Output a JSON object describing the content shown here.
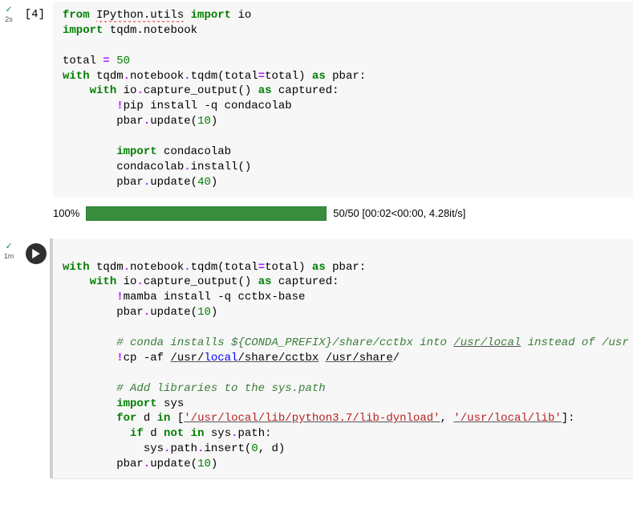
{
  "cell1": {
    "check": "✓",
    "timing": "2s",
    "prompt": "[4]",
    "code": {
      "l1": {
        "kw_from": "from",
        "mod": "IPython.utils",
        "kw_import": "import",
        "name": "io"
      },
      "l2": {
        "kw_import": "import",
        "name": "tqdm.notebook"
      },
      "l3": {
        "a": "total ",
        "b": "=",
        "c": " ",
        "d": "50"
      },
      "l4": {
        "a": "with",
        "b": " tqdm",
        "c": ".",
        "d": "notebook",
        "e": ".",
        "f": "tqdm",
        "g": "(",
        "h": "total",
        "i": "=",
        "j": "total",
        "k": ")",
        "l": " ",
        "m": "as",
        "n": " pbar:"
      },
      "l5": {
        "a": "with",
        "b": " io",
        "c": ".",
        "d": "capture_output",
        "e": "()",
        "f": " ",
        "g": "as",
        "h": " captured:"
      },
      "l6": {
        "a": "!",
        "b": "pip install -q condacolab"
      },
      "l7": {
        "a": "pbar",
        "b": ".",
        "c": "update",
        "d": "(",
        "e": "10",
        "f": ")"
      },
      "l8": {
        "a": "import",
        "b": " condacolab"
      },
      "l9": {
        "a": "condacolab",
        "b": ".",
        "c": "install",
        "d": "()"
      },
      "l10": {
        "a": "pbar",
        "b": ".",
        "c": "update",
        "d": "(",
        "e": "40",
        "f": ")"
      }
    },
    "output": {
      "percent": "100%",
      "stats": "50/50 [00:02<00:00, 4.28it/s]"
    }
  },
  "cell2": {
    "check": "✓",
    "timing": "1m",
    "code": {
      "l1": {
        "a": "with",
        "b": " tqdm",
        "c": ".",
        "d": "notebook",
        "e": ".",
        "f": "tqdm",
        "g": "(",
        "h": "total",
        "i": "=",
        "j": "total",
        "k": ")",
        "l": " ",
        "m": "as",
        "n": " pbar:"
      },
      "l2": {
        "a": "with",
        "b": " io",
        "c": ".",
        "d": "capture_output",
        "e": "()",
        "f": " ",
        "g": "as",
        "h": " captured:"
      },
      "l3": {
        "a": "!",
        "b": "mamba install -q cctbx-base"
      },
      "l4": {
        "a": "pbar",
        "b": ".",
        "c": "update",
        "d": "(",
        "e": "10",
        "f": ")"
      },
      "l5": {
        "a": "# conda installs ${CONDA_PREFIX}/share/cctbx into ",
        "b": "/usr/local",
        "c": " instead of /usr"
      },
      "l6": {
        "a": "!",
        "b": "cp -af ",
        "c": "/usr/",
        "d": "local",
        "e": "/share/cctbx",
        "f": " ",
        "g": "/usr/share",
        "h": "/"
      },
      "l7": {
        "a": "# Add libraries to the sys.path"
      },
      "l8": {
        "a": "import",
        "b": " sys"
      },
      "l9": {
        "a": "for",
        "b": " d ",
        "c": "in",
        "d": " [",
        "e": "'/usr/local/lib/python3.7/lib-dynload'",
        "f": ", ",
        "g": "'/usr/local/lib'",
        "h": "]:"
      },
      "l10": {
        "a": "if",
        "b": " d ",
        "c": "not",
        "d": " ",
        "e": "in",
        "f": " sys",
        "g": ".",
        "h": "path:"
      },
      "l11": {
        "a": "sys",
        "b": ".",
        "c": "path",
        "d": ".",
        "e": "insert",
        "f": "(",
        "g": "0",
        "h": ", d",
        "i": ")"
      },
      "l12": {
        "a": "pbar",
        "b": ".",
        "c": "update",
        "d": "(",
        "e": "10",
        "f": ")"
      }
    }
  }
}
